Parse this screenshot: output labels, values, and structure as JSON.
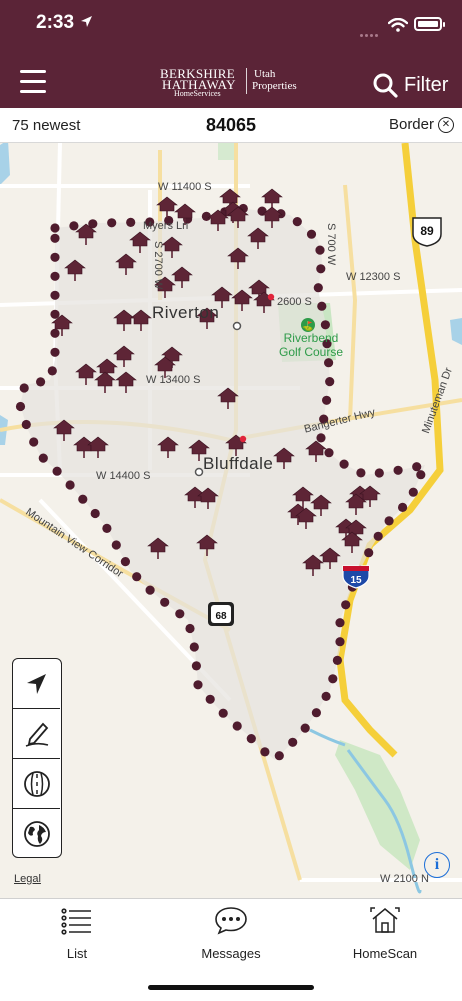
{
  "status": {
    "time": "2:33"
  },
  "header": {
    "logo": {
      "line1": "BERKSHIRE",
      "line2": "HATHAWAY",
      "line3": "HomeServices",
      "right1": "Utah",
      "right2": "Properties"
    },
    "filter_label": "Filter"
  },
  "subbar": {
    "newest": "75 newest",
    "zip": "84065",
    "border": "Border"
  },
  "map": {
    "labels": {
      "w11400": "W 11400 S",
      "myers": "Myers Ln",
      "s700w": "S 700 W",
      "s2700w": "S 2700 W",
      "w12300": "W 12300 S",
      "w12600": "2600 S",
      "riverton": "Riverton",
      "golf": "Riverbend Golf Course",
      "w13400": "W 13400 S",
      "bangerter": "Bangerter Hwy",
      "w14400": "W 14400 S",
      "bluffdale": "Bluffdale",
      "mountain_view": "Mountain View Corridor",
      "minuteman": "Minuteman Dr",
      "w2100": "W 2100 N"
    },
    "shields": {
      "us89": "89",
      "i15": "15",
      "sr68": "68"
    },
    "legal": "Legal"
  },
  "tools": [
    "locate-icon",
    "draw-icon",
    "map-style-icon",
    "globe-icon"
  ],
  "tabs": [
    {
      "label": "List",
      "icon": "list-icon"
    },
    {
      "label": "Messages",
      "icon": "chat-bubble-icon"
    },
    {
      "label": "HomeScan",
      "icon": "house-scan-icon"
    }
  ],
  "colors": {
    "brand": "#5b2437",
    "marker": "#5e2536",
    "highway": "#f5cf3a"
  }
}
